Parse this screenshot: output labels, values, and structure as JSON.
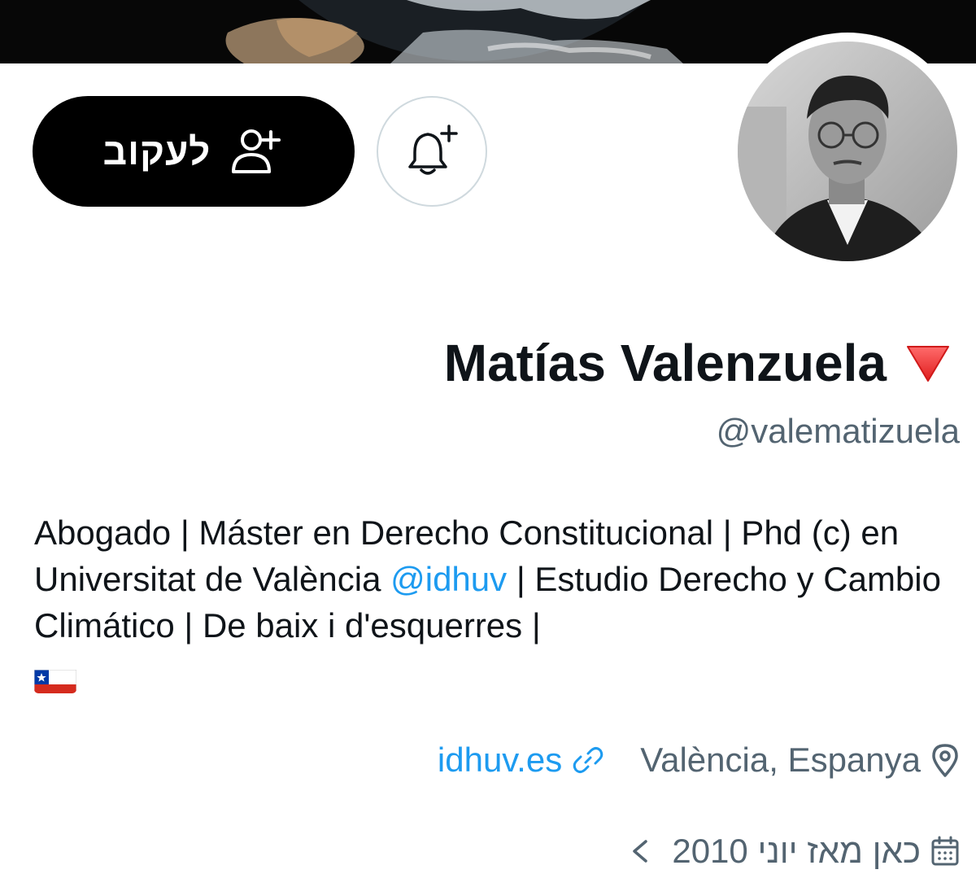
{
  "header": {
    "banner_alt": "Earth from space banner"
  },
  "actions": {
    "follow_label": "לעקוב",
    "follow_icon": "person-add-icon",
    "notify_icon": "bell-plus-icon"
  },
  "profile": {
    "display_name": "Matías Valenzuela",
    "name_emoji": "🔻",
    "handle": "@valematizuela",
    "bio": {
      "part1": "Abogado | Máster en Derecho Constitucional | Phd (c) en Universitat de València ",
      "mention": "@idhuv",
      "part2": " | Estudio Derecho y Cambio Climático | De baix i d'esquerres | ",
      "flag": "🇨🇱"
    },
    "location": "València, Espanya",
    "website": "idhuv.es",
    "joined": "כאן מאז יוני 2010"
  },
  "colors": {
    "accent": "#1d9bf0",
    "secondary_text": "#536471",
    "primary_text": "#0f1419",
    "border": "#cfd9de"
  }
}
